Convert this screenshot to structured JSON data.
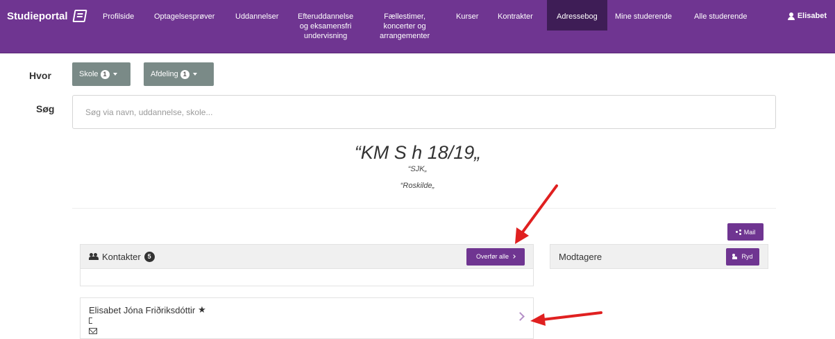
{
  "brand": {
    "name": "Studieportal"
  },
  "nav": {
    "items": [
      {
        "label": "Profilside"
      },
      {
        "label": "Optagelsesprøver"
      },
      {
        "label": "Uddannelser"
      },
      {
        "label": "Efteruddannelse\nog eksamensfri\nundervisning"
      },
      {
        "label": "Fællestimer,\nkoncerter og\narrangementer"
      },
      {
        "label": "Kurser"
      },
      {
        "label": "Kontrakter"
      },
      {
        "label": "Adressebog",
        "active": true
      },
      {
        "label": "Mine studerende"
      },
      {
        "label": "Alle studerende"
      }
    ],
    "user": "Elisabet"
  },
  "filters": {
    "where_label": "Hvor",
    "school_label": "Skole",
    "school_count": "1",
    "department_label": "Afdeling",
    "department_count": "1"
  },
  "search": {
    "label": "Søg",
    "placeholder": "Søg via navn, uddannelse, skole..."
  },
  "class_header": {
    "title": "“KM S h 18/19„",
    "line1": "“SJK„",
    "line2": "“Roskilde„"
  },
  "contacts_panel": {
    "title": "Kontakter",
    "count": "5",
    "transfer_all_label": "Overfør alle"
  },
  "recipients_panel": {
    "title": "Modtagere",
    "mail_label": "Mail",
    "clear_label": "Ryd"
  },
  "contacts": [
    {
      "name": "Elisabet Jóna Friðriksdóttir"
    }
  ],
  "colors": {
    "brand": "#6f3591",
    "nav_active": "#3e1d56",
    "filter_button": "#7a8a87",
    "annotation_arrow": "#e02020"
  }
}
